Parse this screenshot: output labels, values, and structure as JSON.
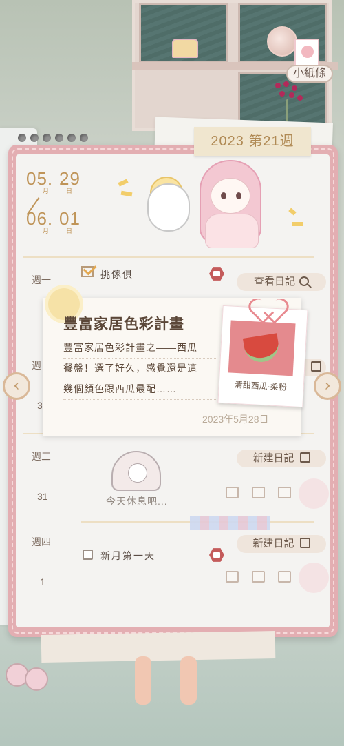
{
  "header": {
    "memo_label": "小紙條",
    "week_label": "2023 第21週"
  },
  "date_range": {
    "start_month": "05.",
    "start_day": "29",
    "end_month": "06.",
    "end_day": "01",
    "month_unit": "月",
    "day_unit": "日"
  },
  "rows": [
    {
      "weekday": "週一",
      "day": "",
      "task": "挑傢俱",
      "task_checked": true,
      "action": "查看日記",
      "action_icon": "search-icon"
    },
    {
      "weekday": "週",
      "day": "3",
      "action": "",
      "action_icon": "edit-icon"
    },
    {
      "weekday": "週三",
      "day": "31",
      "rest_text": "今天休息吧...",
      "action": "新建日記",
      "action_icon": "edit-icon"
    },
    {
      "weekday": "週四",
      "day": "1",
      "task": "新月第一天",
      "task_checked": false,
      "action": "新建日記",
      "action_icon": "edit-icon"
    }
  ],
  "popup": {
    "title": "豐富家居色彩計畫",
    "body_lines": [
      "豐富家居色彩計畫之——西瓜",
      "餐盤！選了好久，感覺還是這",
      "幾個顏色跟西瓜最配……"
    ],
    "date": "2023年5月28日",
    "photo_label": "清甜西瓜·柔粉"
  },
  "nav": {
    "prev": "‹",
    "next": "›"
  },
  "colors": {
    "frame": "#e3aeb2",
    "accent_gold": "#bf9458",
    "text_brown": "#5b4738"
  }
}
